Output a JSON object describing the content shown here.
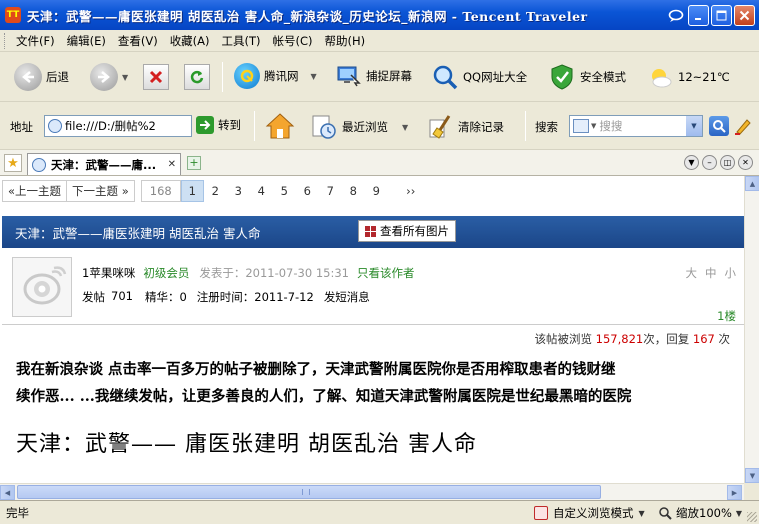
{
  "window": {
    "title": "天津：武警——庸医张建明 胡医乱治 害人命_新浪杂谈_历史论坛_新浪网 - Tencent Traveler",
    "app_icon_glyph": "TT"
  },
  "menu": [
    "文件(F)",
    "编辑(E)",
    "查看(V)",
    "收藏(A)",
    "工具(T)",
    "帐号(C)",
    "帮助(H)"
  ],
  "toolbar": {
    "back_label": "后退",
    "tencent_label": "腾讯网",
    "capture_label": "捕捉屏幕",
    "qqsites_label": "QQ网址大全",
    "safemode_label": "安全模式",
    "weather_label": "12~21℃"
  },
  "address": {
    "label": "地址",
    "value": "file:///D:/删帖%2",
    "go_label": "转到",
    "recent_label": "最近浏览",
    "clear_label": "清除记录",
    "search_label": "搜索",
    "search_placeholder": "搜搜"
  },
  "tab": {
    "title": "天津：武警——庸...",
    "close": "✕"
  },
  "pager": {
    "prev": "«上一主题",
    "next": "下一主题 »",
    "total": "168",
    "pages": [
      "1",
      "2",
      "3",
      "4",
      "5",
      "6",
      "7",
      "8",
      "9"
    ],
    "current": "1",
    "more": "››"
  },
  "thread": {
    "title": "天津：武警——庸医张建明  胡医乱治  害人命",
    "view_all_pics": "查看所有图片"
  },
  "post": {
    "username": "1苹果咪咪",
    "rank": "初级会员",
    "posted_prefix": "发表于：",
    "posted_time": "2011-07-30 15:31",
    "only_author": "只看该作者",
    "font_sizes": [
      "大",
      "中",
      "小"
    ],
    "posts_label": "发帖",
    "posts_count": "701",
    "essence_label": "精华：",
    "essence_count": "0",
    "reg_label": "注册时间：",
    "reg_date": "2011-7-12",
    "short_msg": "发短消息",
    "floor": "1楼",
    "stats_prefix": "该帖被浏览",
    "views": "157,821",
    "stats_mid": "次，回复",
    "replies": "167",
    "stats_suffix": "次",
    "body_line1": "我在新浪杂谈  点击率一百多万的帖子被删除了，天津武警附属医院你是否用榨取患者的钱财继",
    "body_line2": "续作恶... ...我继续发帖，让更多善良的人们，了解、知道天津武警附属医院是世纪最黑暗的医院",
    "big_title": "天津：武警—— 庸医张建明  胡医乱治  害人命"
  },
  "statusbar": {
    "status": "完毕",
    "browse_mode": "自定义浏览模式",
    "zoom": "缩放100%"
  },
  "colors": {
    "title_blue": "#0a55d6",
    "header_blue": "#1b4688",
    "rank_green": "#2a8a2a",
    "stat_red": "#cc0000"
  }
}
